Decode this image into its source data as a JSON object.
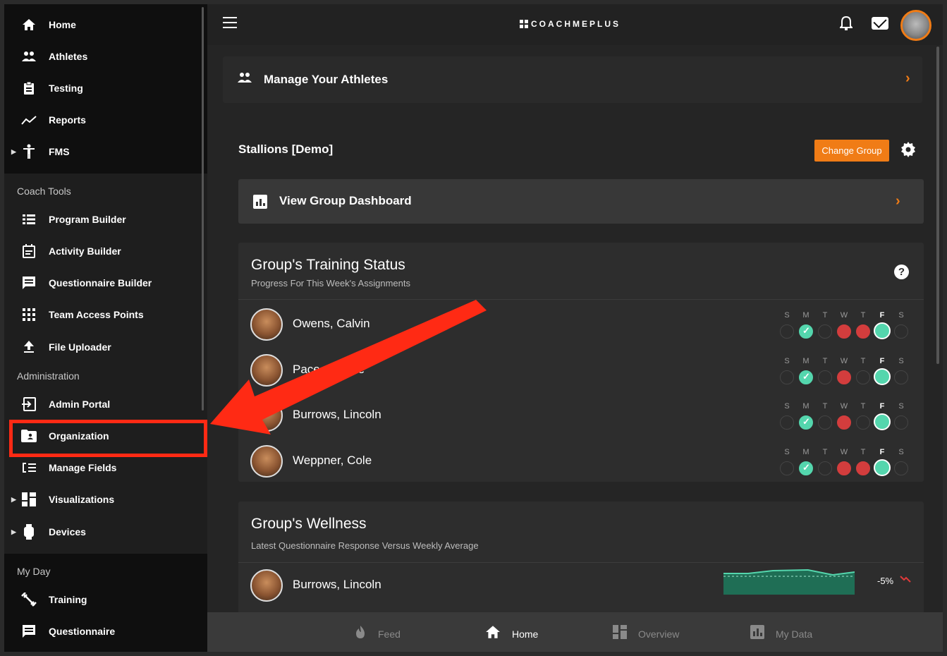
{
  "sidebar": {
    "top_items": [
      {
        "label": "Home",
        "icon": "home-icon"
      },
      {
        "label": "Athletes",
        "icon": "people-icon"
      },
      {
        "label": "Testing",
        "icon": "clipboard-icon"
      },
      {
        "label": "Reports",
        "icon": "trend-icon"
      },
      {
        "label": "FMS",
        "icon": "person-icon",
        "expandable": true
      }
    ],
    "coach_tools": {
      "heading": "Coach Tools",
      "items": [
        {
          "label": "Program Builder",
          "icon": "list-icon"
        },
        {
          "label": "Activity Builder",
          "icon": "calendar-icon"
        },
        {
          "label": "Questionnaire Builder",
          "icon": "chat-icon"
        },
        {
          "label": "Team Access Points",
          "icon": "grid-icon"
        },
        {
          "label": "File Uploader",
          "icon": "upload-icon"
        }
      ]
    },
    "administration": {
      "heading": "Administration",
      "items": [
        {
          "label": "Admin Portal",
          "icon": "login-icon"
        },
        {
          "label": "Organization",
          "icon": "folder-person-icon",
          "highlighted": true
        },
        {
          "label": "Manage Fields",
          "icon": "fields-icon"
        },
        {
          "label": "Visualizations",
          "icon": "dashboard-icon",
          "expandable": true
        },
        {
          "label": "Devices",
          "icon": "watch-icon",
          "expandable": true
        }
      ]
    },
    "my_day": {
      "heading": "My Day",
      "items": [
        {
          "label": "Training",
          "icon": "dumbbell-icon"
        },
        {
          "label": "Questionnaire",
          "icon": "chat-icon"
        }
      ]
    }
  },
  "topbar": {
    "logo_text": "COACHMEPLUS"
  },
  "manage_athletes": {
    "label": "Manage Your Athletes"
  },
  "group": {
    "name": "Stallions [Demo]",
    "change_button": "Change Group"
  },
  "view_dashboard": {
    "label": "View Group Dashboard"
  },
  "training_status": {
    "title": "Group's Training Status",
    "subtitle": "Progress For This Week's Assignments",
    "day_letters": [
      "S",
      "M",
      "T",
      "W",
      "T",
      "F",
      "S"
    ],
    "athletes": [
      {
        "name": "Owens, Calvin",
        "status": [
          "empty",
          "green-check",
          "empty",
          "red",
          "red",
          "green-today",
          "empty"
        ]
      },
      {
        "name": "Pace, Charlie",
        "status": [
          "empty",
          "green-check",
          "empty",
          "red",
          "empty",
          "green-today",
          "empty"
        ]
      },
      {
        "name": "Burrows, Lincoln",
        "status": [
          "empty",
          "green-check",
          "empty",
          "red",
          "empty",
          "green-today",
          "empty"
        ]
      },
      {
        "name": "Weppner, Cole",
        "status": [
          "empty",
          "green-check",
          "empty",
          "red",
          "red",
          "green-today",
          "empty"
        ]
      }
    ]
  },
  "wellness": {
    "title": "Group's Wellness",
    "subtitle": "Latest Questionnaire Response Versus Weekly Average",
    "athletes": [
      {
        "name": "Burrows, Lincoln",
        "delta": "-5%"
      }
    ]
  },
  "bottom_nav": [
    {
      "label": "Feed",
      "icon": "flame-icon",
      "active": false
    },
    {
      "label": "Home",
      "icon": "home-icon",
      "active": true
    },
    {
      "label": "Overview",
      "icon": "dashboard-icon",
      "active": false
    },
    {
      "label": "My Data",
      "icon": "chart-icon",
      "active": false
    }
  ],
  "colors": {
    "accent": "#f07c16",
    "highlight": "#ff2a14",
    "status_green": "#54d6ad",
    "status_red": "#d33d3d"
  }
}
